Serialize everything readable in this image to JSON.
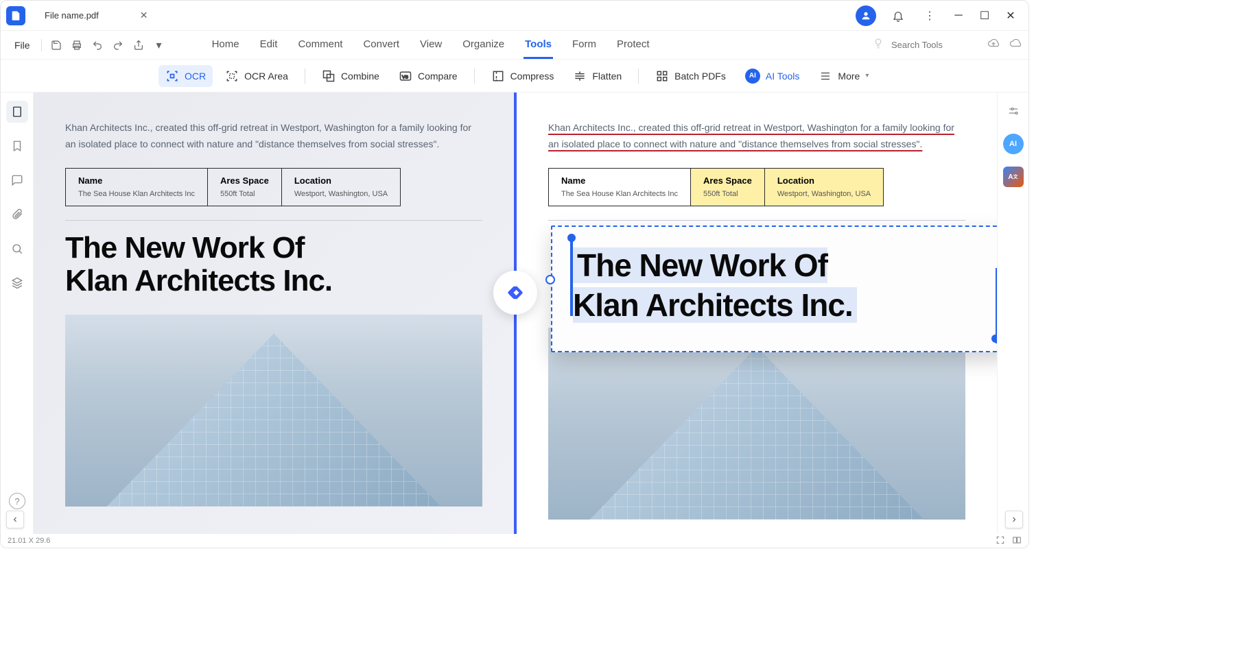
{
  "titlebar": {
    "file_name": "File name.pdf"
  },
  "menu": {
    "file": "File"
  },
  "nav": {
    "items": [
      "Home",
      "Edit",
      "Comment",
      "Convert",
      "View",
      "Organize",
      "Tools",
      "Form",
      "Protect"
    ],
    "active_index": 6,
    "search_placeholder": "Search Tools"
  },
  "toolbar": {
    "ocr": "OCR",
    "ocr_area": "OCR Area",
    "combine": "Combine",
    "compare": "Compare",
    "compress": "Compress",
    "flatten": "Flatten",
    "batch": "Batch PDFs",
    "ai_tools": "AI Tools",
    "more": "More"
  },
  "doc": {
    "intro": "Khan Architects Inc., created this off-grid retreat in Westport, Washington for a family looking for an isolated place to connect with nature and \"distance themselves from social stresses\".",
    "table": {
      "cols": [
        {
          "header": "Name",
          "value": "The Sea House Klan Architects Inc"
        },
        {
          "header": "Ares Space",
          "value": "550ft Total"
        },
        {
          "header": "Location",
          "value": "Westport, Washington, USA"
        }
      ]
    },
    "headline_l1": "The New Work Of",
    "headline_l2": "Klan Architects Inc."
  },
  "status": {
    "coords": "21.01 X 29.6"
  }
}
